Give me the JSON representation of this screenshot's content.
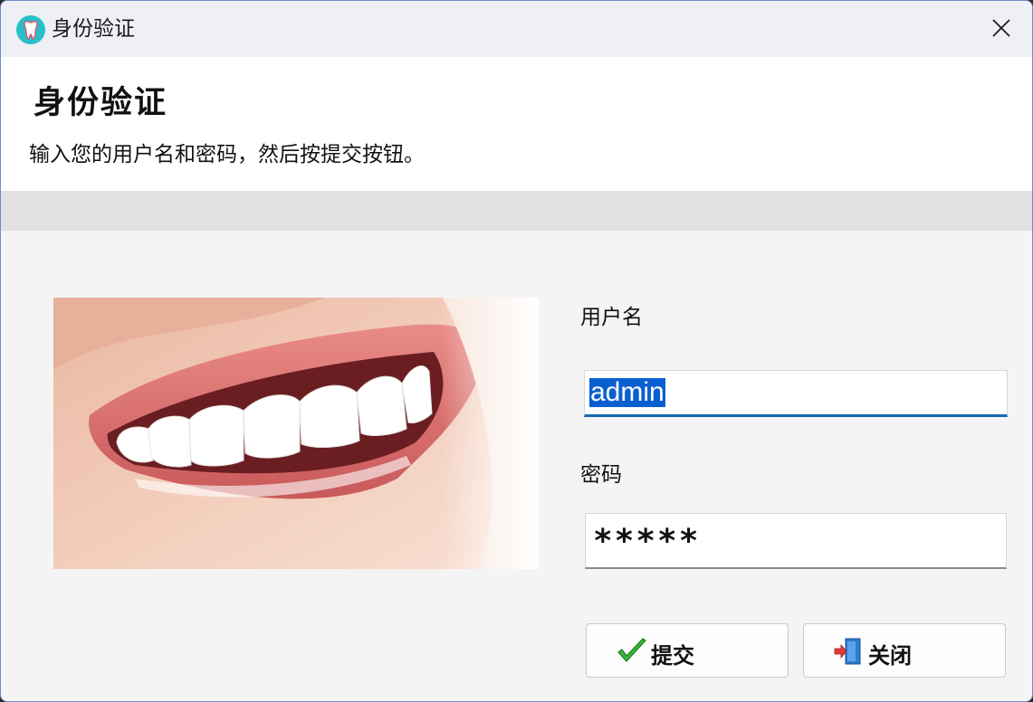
{
  "window": {
    "title": "身份验证",
    "icon": "tooth-icon"
  },
  "header": {
    "title": "身份验证",
    "description": "输入您的用户名和密码，然后按提交按钮。"
  },
  "form": {
    "username_label": "用户名",
    "username_value": "admin",
    "password_label": "密码",
    "password_value": "*****"
  },
  "buttons": {
    "submit_label": "提交",
    "submit_icon": "checkmark-icon",
    "close_label": "关闭",
    "close_icon": "exit-door-icon"
  },
  "colors": {
    "accent": "#1766b8",
    "selection": "#0a5fd0"
  }
}
